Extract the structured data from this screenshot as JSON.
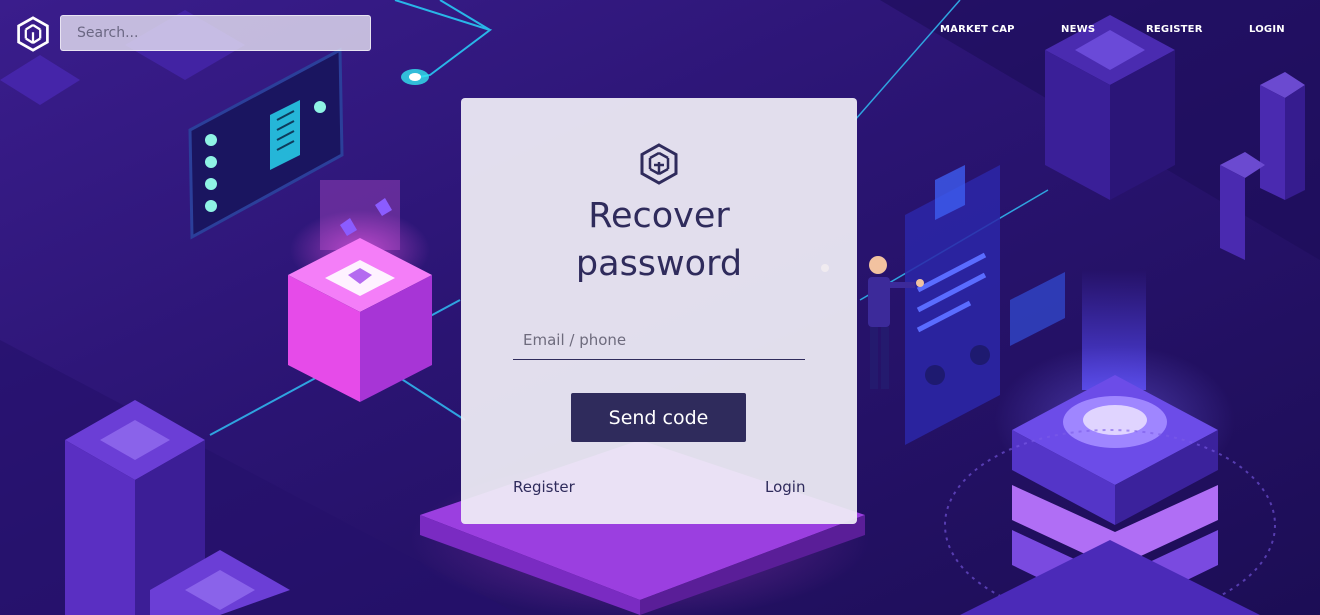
{
  "header": {
    "logo_icon": "cube-logo-icon",
    "search": {
      "placeholder": "Search...",
      "value": ""
    },
    "nav": [
      {
        "label": "MARKET CAP"
      },
      {
        "label": "NEWS"
      },
      {
        "label": "REGISTER"
      },
      {
        "label": "LOGIN"
      }
    ]
  },
  "card": {
    "logo_icon": "cube-logo-icon",
    "title_line1": "Recover",
    "title_line2": "password",
    "field": {
      "placeholder": "Email / phone",
      "value": ""
    },
    "submit_label": "Send code",
    "register_link": "Register",
    "login_link": "Login"
  },
  "colors": {
    "accent": "#2f2b5c",
    "background": "#2a1470",
    "card": "#f0eef6"
  }
}
